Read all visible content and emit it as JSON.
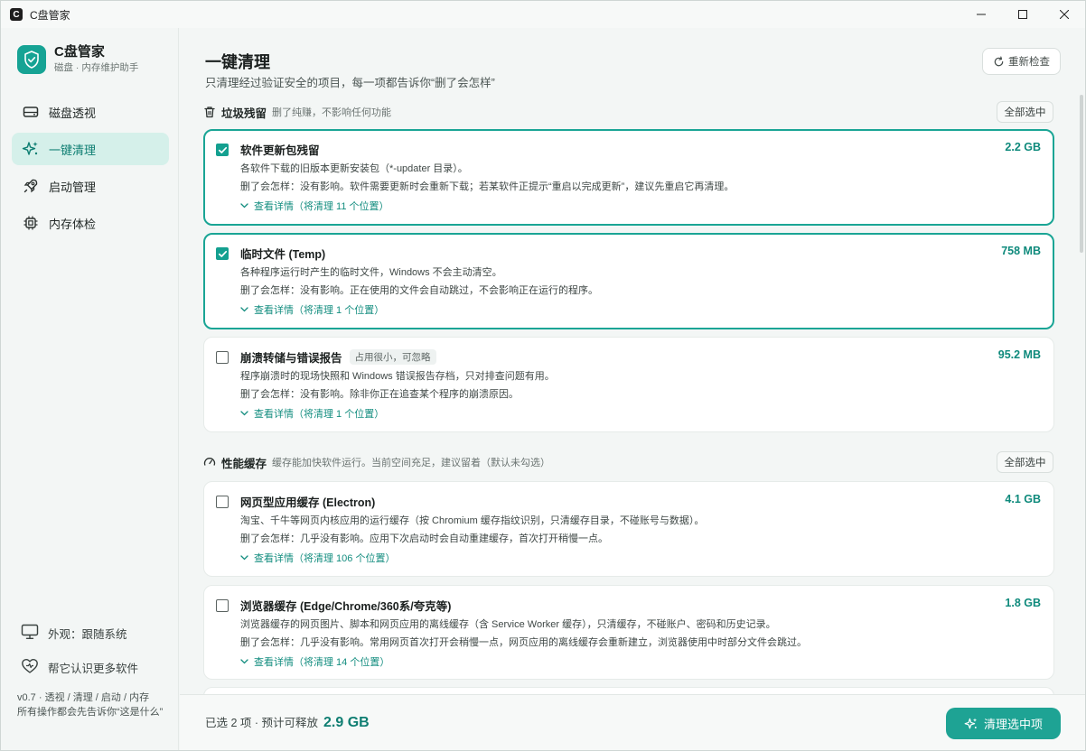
{
  "window": {
    "title": "C盘管家",
    "app_icon_letter": "C"
  },
  "brand": {
    "name": "C盘管家",
    "subtitle": "磁盘 · 内存维护助手"
  },
  "nav": [
    {
      "label": "磁盘透视",
      "icon": "disk-icon",
      "active": false
    },
    {
      "label": "一键清理",
      "icon": "sparkle-icon",
      "active": true
    },
    {
      "label": "启动管理",
      "icon": "rocket-icon",
      "active": false
    },
    {
      "label": "内存体检",
      "icon": "chip-icon",
      "active": false
    }
  ],
  "sidebar_bottom": {
    "appearance": "外观：跟随系统",
    "help": "帮它认识更多软件",
    "version_line1": "v0.7 · 透视 / 清理 / 启动 / 内存",
    "version_line2": "所有操作都会先告诉你“这是什么”"
  },
  "header": {
    "title": "一键清理",
    "subtitle": "只清理经过验证安全的项目，每一项都告诉你“删了会怎样”",
    "recheck": "重新检查"
  },
  "sections": [
    {
      "title": "垃圾残留",
      "desc": "删了纯赚，不影响任何功能",
      "select_all": "全部选中",
      "items": [
        {
          "title": "软件更新包残留",
          "tag": "",
          "size": "2.2 GB",
          "checked": true,
          "desc": "各软件下载的旧版本更新安装包（*-updater 目录）。",
          "impact": "删了会怎样：没有影响。软件需要更新时会重新下载；若某软件正提示“重启以完成更新”，建议先重启它再清理。",
          "detail": "查看详情（将清理 11 个位置）"
        },
        {
          "title": "临时文件 (Temp)",
          "tag": "",
          "size": "758 MB",
          "checked": true,
          "desc": "各种程序运行时产生的临时文件，Windows 不会主动清空。",
          "impact": "删了会怎样：没有影响。正在使用的文件会自动跳过，不会影响正在运行的程序。",
          "detail": "查看详情（将清理 1 个位置）"
        },
        {
          "title": "崩溃转储与错误报告",
          "tag": "占用很小，可忽略",
          "size": "95.2 MB",
          "checked": false,
          "desc": "程序崩溃时的现场快照和 Windows 错误报告存档，只对排查问题有用。",
          "impact": "删了会怎样：没有影响。除非你正在追查某个程序的崩溃原因。",
          "detail": "查看详情（将清理 1 个位置）"
        }
      ]
    },
    {
      "title": "性能缓存",
      "desc": "缓存能加快软件运行。当前空间充足，建议留着（默认未勾选）",
      "select_all": "全部选中",
      "items": [
        {
          "title": "网页型应用缓存 (Electron)",
          "tag": "",
          "size": "4.1 GB",
          "checked": false,
          "desc": "淘宝、千牛等网页内核应用的运行缓存（按 Chromium 缓存指纹识别，只清缓存目录，不碰账号与数据）。",
          "impact": "删了会怎样：几乎没有影响。应用下次启动时会自动重建缓存，首次打开稍慢一点。",
          "detail": "查看详情（将清理 106 个位置）"
        },
        {
          "title": "浏览器缓存 (Edge/Chrome/360系/夸克等)",
          "tag": "",
          "size": "1.8 GB",
          "checked": false,
          "desc": "浏览器缓存的网页图片、脚本和网页应用的离线缓存（含 Service Worker 缓存），只清缓存，不碰账户、密码和历史记录。",
          "impact": "删了会怎样：几乎没有影响。常用网页首次打开会稍慢一点，网页应用的离线缓存会重新建立，浏览器使用中时部分文件会跳过。",
          "detail": "查看详情（将清理 14 个位置）"
        }
      ]
    }
  ],
  "footer": {
    "summary": "已选 2 项 · 预计可释放",
    "total": "2.9 GB",
    "clean_button": "清理选中项"
  },
  "colors": {
    "accent": "#1ea394",
    "accent_text": "#0f8a7c",
    "nav_active_bg": "#d5f0ea"
  }
}
